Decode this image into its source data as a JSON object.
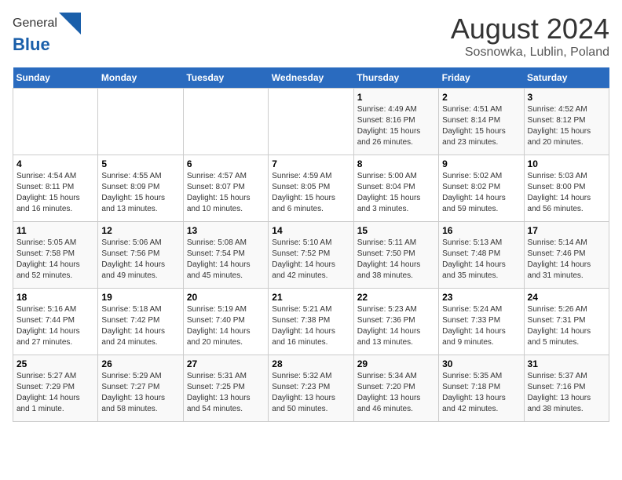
{
  "logo": {
    "general": "General",
    "blue": "Blue"
  },
  "title": "August 2024",
  "subtitle": "Sosnowka, Lublin, Poland",
  "days_of_week": [
    "Sunday",
    "Monday",
    "Tuesday",
    "Wednesday",
    "Thursday",
    "Friday",
    "Saturday"
  ],
  "weeks": [
    [
      {
        "day": "",
        "info": ""
      },
      {
        "day": "",
        "info": ""
      },
      {
        "day": "",
        "info": ""
      },
      {
        "day": "",
        "info": ""
      },
      {
        "day": "1",
        "info": "Sunrise: 4:49 AM\nSunset: 8:16 PM\nDaylight: 15 hours\nand 26 minutes."
      },
      {
        "day": "2",
        "info": "Sunrise: 4:51 AM\nSunset: 8:14 PM\nDaylight: 15 hours\nand 23 minutes."
      },
      {
        "day": "3",
        "info": "Sunrise: 4:52 AM\nSunset: 8:12 PM\nDaylight: 15 hours\nand 20 minutes."
      }
    ],
    [
      {
        "day": "4",
        "info": "Sunrise: 4:54 AM\nSunset: 8:11 PM\nDaylight: 15 hours\nand 16 minutes."
      },
      {
        "day": "5",
        "info": "Sunrise: 4:55 AM\nSunset: 8:09 PM\nDaylight: 15 hours\nand 13 minutes."
      },
      {
        "day": "6",
        "info": "Sunrise: 4:57 AM\nSunset: 8:07 PM\nDaylight: 15 hours\nand 10 minutes."
      },
      {
        "day": "7",
        "info": "Sunrise: 4:59 AM\nSunset: 8:05 PM\nDaylight: 15 hours\nand 6 minutes."
      },
      {
        "day": "8",
        "info": "Sunrise: 5:00 AM\nSunset: 8:04 PM\nDaylight: 15 hours\nand 3 minutes."
      },
      {
        "day": "9",
        "info": "Sunrise: 5:02 AM\nSunset: 8:02 PM\nDaylight: 14 hours\nand 59 minutes."
      },
      {
        "day": "10",
        "info": "Sunrise: 5:03 AM\nSunset: 8:00 PM\nDaylight: 14 hours\nand 56 minutes."
      }
    ],
    [
      {
        "day": "11",
        "info": "Sunrise: 5:05 AM\nSunset: 7:58 PM\nDaylight: 14 hours\nand 52 minutes."
      },
      {
        "day": "12",
        "info": "Sunrise: 5:06 AM\nSunset: 7:56 PM\nDaylight: 14 hours\nand 49 minutes."
      },
      {
        "day": "13",
        "info": "Sunrise: 5:08 AM\nSunset: 7:54 PM\nDaylight: 14 hours\nand 45 minutes."
      },
      {
        "day": "14",
        "info": "Sunrise: 5:10 AM\nSunset: 7:52 PM\nDaylight: 14 hours\nand 42 minutes."
      },
      {
        "day": "15",
        "info": "Sunrise: 5:11 AM\nSunset: 7:50 PM\nDaylight: 14 hours\nand 38 minutes."
      },
      {
        "day": "16",
        "info": "Sunrise: 5:13 AM\nSunset: 7:48 PM\nDaylight: 14 hours\nand 35 minutes."
      },
      {
        "day": "17",
        "info": "Sunrise: 5:14 AM\nSunset: 7:46 PM\nDaylight: 14 hours\nand 31 minutes."
      }
    ],
    [
      {
        "day": "18",
        "info": "Sunrise: 5:16 AM\nSunset: 7:44 PM\nDaylight: 14 hours\nand 27 minutes."
      },
      {
        "day": "19",
        "info": "Sunrise: 5:18 AM\nSunset: 7:42 PM\nDaylight: 14 hours\nand 24 minutes."
      },
      {
        "day": "20",
        "info": "Sunrise: 5:19 AM\nSunset: 7:40 PM\nDaylight: 14 hours\nand 20 minutes."
      },
      {
        "day": "21",
        "info": "Sunrise: 5:21 AM\nSunset: 7:38 PM\nDaylight: 14 hours\nand 16 minutes."
      },
      {
        "day": "22",
        "info": "Sunrise: 5:23 AM\nSunset: 7:36 PM\nDaylight: 14 hours\nand 13 minutes."
      },
      {
        "day": "23",
        "info": "Sunrise: 5:24 AM\nSunset: 7:33 PM\nDaylight: 14 hours\nand 9 minutes."
      },
      {
        "day": "24",
        "info": "Sunrise: 5:26 AM\nSunset: 7:31 PM\nDaylight: 14 hours\nand 5 minutes."
      }
    ],
    [
      {
        "day": "25",
        "info": "Sunrise: 5:27 AM\nSunset: 7:29 PM\nDaylight: 14 hours\nand 1 minute."
      },
      {
        "day": "26",
        "info": "Sunrise: 5:29 AM\nSunset: 7:27 PM\nDaylight: 13 hours\nand 58 minutes."
      },
      {
        "day": "27",
        "info": "Sunrise: 5:31 AM\nSunset: 7:25 PM\nDaylight: 13 hours\nand 54 minutes."
      },
      {
        "day": "28",
        "info": "Sunrise: 5:32 AM\nSunset: 7:23 PM\nDaylight: 13 hours\nand 50 minutes."
      },
      {
        "day": "29",
        "info": "Sunrise: 5:34 AM\nSunset: 7:20 PM\nDaylight: 13 hours\nand 46 minutes."
      },
      {
        "day": "30",
        "info": "Sunrise: 5:35 AM\nSunset: 7:18 PM\nDaylight: 13 hours\nand 42 minutes."
      },
      {
        "day": "31",
        "info": "Sunrise: 5:37 AM\nSunset: 7:16 PM\nDaylight: 13 hours\nand 38 minutes."
      }
    ]
  ]
}
